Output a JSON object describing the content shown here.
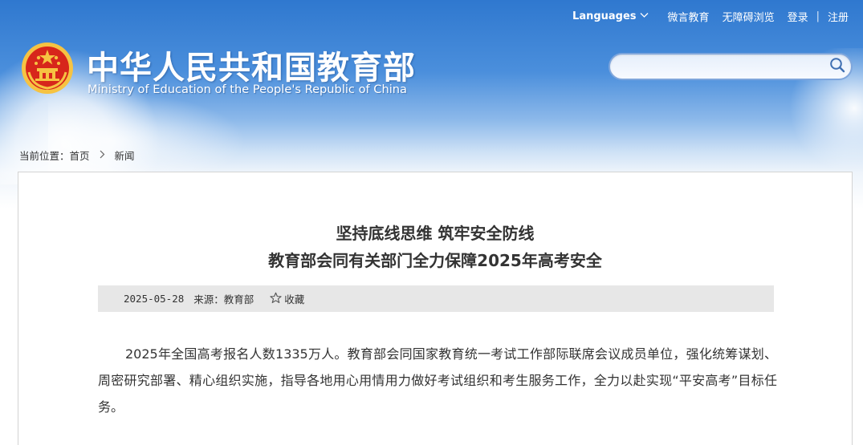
{
  "header": {
    "title_cn": "中华人民共和国教育部",
    "title_en": "Ministry of Education of the People's Republic of China"
  },
  "topbar": {
    "languages": "Languages",
    "weiyan": "微言教育",
    "accessible": "无障碍浏览",
    "login": "登录",
    "separator": "|",
    "register": "注册"
  },
  "search": {
    "placeholder": "",
    "value": ""
  },
  "breadcrumb": {
    "prefix": "当前位置：",
    "home": "首页",
    "current": "新闻"
  },
  "article": {
    "headline_line1": "坚持底线思维 筑牢安全防线",
    "headline_line2": "教育部会同有关部门全力保障2025年高考安全",
    "date": "2025-05-28",
    "source": "来源：教育部",
    "favorite": "收藏",
    "paragraph1": "2025年全国高考报名人数1335万人。教育部会同国家教育统一考试工作部际联席会议成员单位，强化统筹谋划、周密研究部署、精心组织实施，指导各地用心用情用力做好考试组织和考生服务工作，全力以赴实现“平安高考”目标任务。"
  },
  "colors": {
    "header_blue": "#2f78cf",
    "emblem_red": "#d7261b",
    "emblem_gold": "#f6c342",
    "meta_bg": "#e7e7e7"
  },
  "icons": {
    "search": "search-icon",
    "chevron": "chevron-down-icon",
    "star": "star-outline-icon",
    "emblem": "national-emblem-icon"
  }
}
